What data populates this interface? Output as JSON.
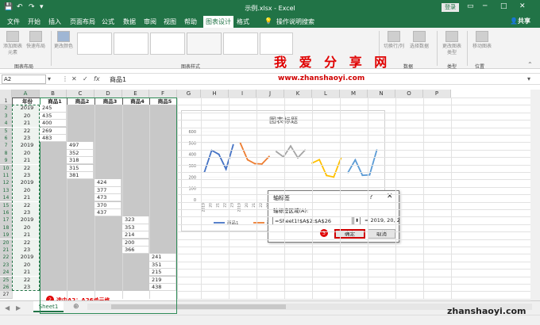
{
  "window": {
    "title": "示例.xlsx - Excel",
    "login": "登录"
  },
  "menu": {
    "tabs": [
      "文件",
      "开始",
      "插入",
      "页面布局",
      "公式",
      "数据",
      "审阅",
      "视图",
      "帮助",
      "图表设计",
      "格式"
    ],
    "tell_me": "操作说明搜索",
    "share": "共享"
  },
  "ribbon": {
    "add_element": "添加图表元素",
    "quick_layout": "快速布局",
    "change_color": "更改颜色",
    "chart_layout_group": "图表布局",
    "chart_styles_group": "图表样式",
    "switch_row_col": "切换行/列",
    "select_data": "选择数据",
    "data_group": "数据",
    "change_type": "更改图表类型",
    "type_group": "类型",
    "move_chart": "移动图表",
    "location_group": "位置"
  },
  "watermark": "我 爱 分 享 网",
  "site_url": "www.zhanshaoyi.com",
  "formula_bar": {
    "name_box": "A2",
    "fx": "fx",
    "content": "商品1"
  },
  "columns": [
    "A",
    "B",
    "C",
    "D",
    "E",
    "F",
    "G",
    "H",
    "I",
    "J",
    "K",
    "L",
    "M",
    "N",
    "O",
    "P"
  ],
  "rows": [
    "1",
    "2",
    "3",
    "4",
    "5",
    "6",
    "7",
    "8",
    "9",
    "10",
    "11",
    "12",
    "13",
    "14",
    "15",
    "16",
    "17",
    "18",
    "19",
    "20",
    "21",
    "22",
    "23",
    "24",
    "25",
    "26",
    "27"
  ],
  "headers": [
    "年份",
    "商品1",
    "商品2",
    "商品3",
    "商品4",
    "商品5"
  ],
  "col_a": [
    "2019",
    "20",
    "21",
    "22",
    "23",
    "2019",
    "20",
    "21",
    "22",
    "23",
    "2019",
    "20",
    "21",
    "22",
    "23",
    "2019",
    "20",
    "21",
    "22",
    "23",
    "2019",
    "20",
    "21",
    "22",
    "23"
  ],
  "values": {
    "b": [
      "245",
      "435",
      "400",
      "269",
      "483"
    ],
    "c": [
      "497",
      "352",
      "318",
      "315",
      "381"
    ],
    "d": [
      "424",
      "377",
      "473",
      "370",
      "437"
    ],
    "e": [
      "323",
      "353",
      "214",
      "200",
      "366"
    ],
    "f": [
      "241",
      "351",
      "215",
      "219",
      "438"
    ]
  },
  "chart_data": {
    "type": "line",
    "title": "图表标题",
    "ylim": [
      0,
      600
    ],
    "yticks": [
      "0",
      "100",
      "200",
      "300",
      "400",
      "500",
      "600"
    ],
    "xlabels": [
      "2019",
      "20",
      "21",
      "22",
      "23",
      "2019",
      "20",
      "21",
      "22",
      "23",
      "2019",
      "20",
      "21",
      "22",
      "23",
      "2019",
      "20",
      "21",
      "22",
      "23",
      "2019",
      "20",
      "21",
      "22",
      "23"
    ],
    "series": [
      {
        "name": "商品1",
        "color": "#4472c4",
        "values": [
          245,
          435,
          400,
          269,
          483
        ]
      },
      {
        "name": "商品2",
        "color": "#ed7d31",
        "values": [
          497,
          352,
          318,
          315,
          381
        ]
      },
      {
        "name": "商品3",
        "color": "#a5a5a5",
        "values": [
          424,
          377,
          473,
          370,
          437
        ]
      },
      {
        "name": "商品4",
        "color": "#ffc000",
        "values": [
          323,
          353,
          214,
          200,
          366
        ]
      },
      {
        "name": "商品5",
        "color": "#5b9bd5",
        "values": [
          241,
          351,
          215,
          219,
          438
        ]
      }
    ]
  },
  "dialog": {
    "title": "轴标签",
    "help": "?",
    "close": "✕",
    "label": "轴标签区域(A):",
    "input": "=Sheet1!$A$2:$A$26",
    "preview": "= 2019, 20, 21,...",
    "ok": "确定",
    "cancel": "取消"
  },
  "annotations": {
    "step2": "2",
    "step2_text": "选中A2：A26单元格",
    "step3": "3"
  },
  "sheet_tab": "Sheet1",
  "bottom_url": "zhanshaoyi.com"
}
